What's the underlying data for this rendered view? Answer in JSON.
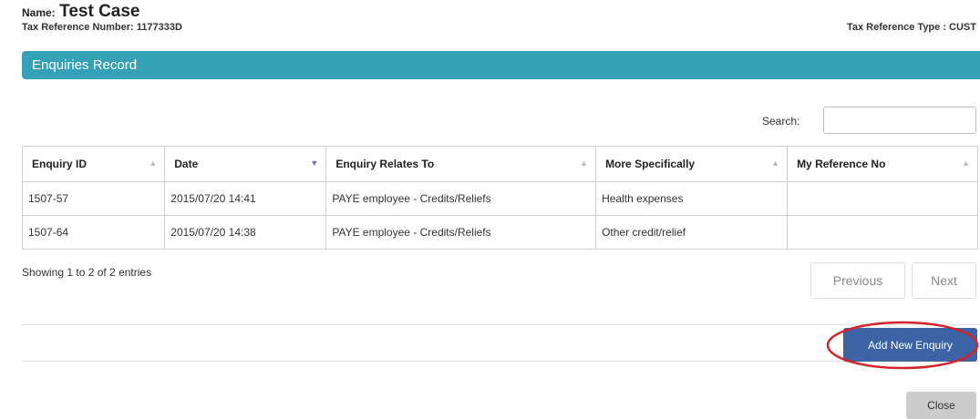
{
  "header": {
    "name_label": "Name:",
    "name_value": "Test Case",
    "tax_ref": "Tax Reference Number: 1177333D",
    "tax_type": "Tax Reference Type : CUST"
  },
  "panel": {
    "title": "Enquiries Record"
  },
  "search": {
    "label": "Search:",
    "value": ""
  },
  "table": {
    "columns": [
      "Enquiry ID",
      "Date",
      "Enquiry Relates To",
      "More Specifically",
      "My Reference No"
    ],
    "rows": [
      [
        "1507-57",
        "2015/07/20 14:41",
        "PAYE employee - Credits/Reliefs",
        "Health expenses",
        ""
      ],
      [
        "1507-64",
        "2015/07/20 14:38",
        "PAYE employee - Credits/Reliefs",
        "Other credit/relief",
        ""
      ]
    ]
  },
  "footer": {
    "showing": "Showing 1 to 2 of 2 entries",
    "previous": "Previous",
    "next": "Next"
  },
  "actions": {
    "add_new": "Add New Enquiry",
    "close": "Close"
  },
  "colors": {
    "panel_bar": "#35a1b7",
    "primary_button": "#3b63a6",
    "highlight_ring": "#d6232a",
    "close_button": "#cccccc"
  },
  "icons": {
    "sort": "sort-both-icon",
    "sort_active": "sort-desc-icon"
  }
}
